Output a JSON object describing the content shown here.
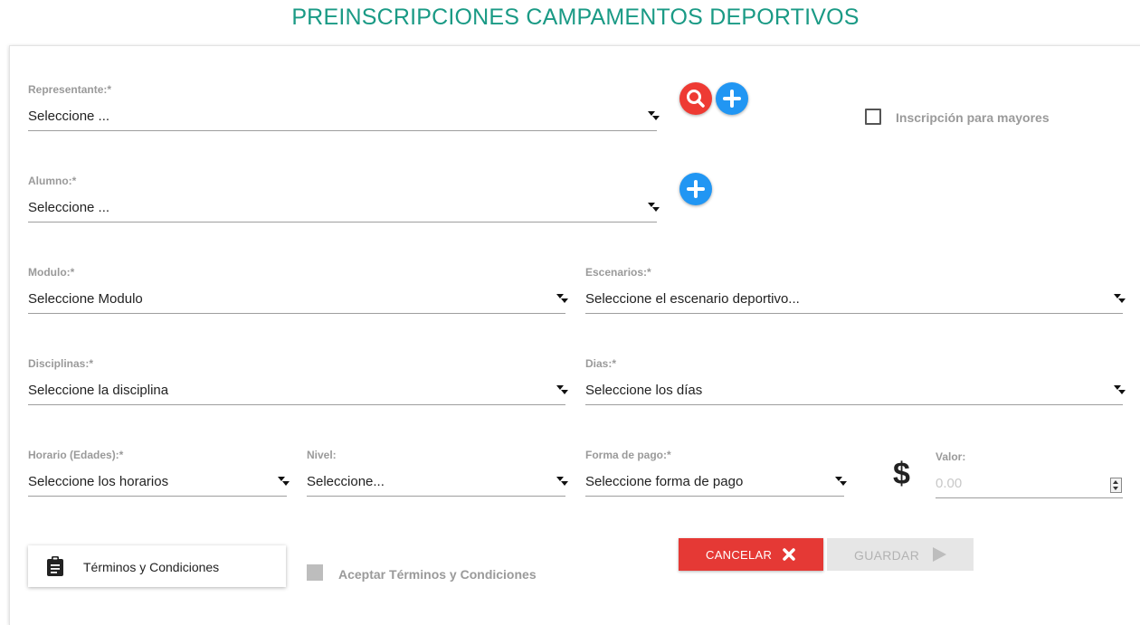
{
  "title": "PREINSCRIPCIONES CAMPAMENTOS DEPORTIVOS",
  "representante": {
    "label": "Representante:*",
    "value": "Seleccione ..."
  },
  "mayores": {
    "label": "Inscripción para mayores",
    "checked": false
  },
  "alumno": {
    "label": "Alumno:*",
    "value": "Seleccione ..."
  },
  "modulo": {
    "label": "Modulo:*",
    "value": "Seleccione Modulo"
  },
  "escenarios": {
    "label": "Escenarios:*",
    "value": "Seleccione el escenario deportivo..."
  },
  "disciplinas": {
    "label": "Disciplinas:*",
    "value": "Seleccione la disciplina"
  },
  "dias": {
    "label": "Dias:*",
    "value": "Seleccione los días"
  },
  "horario": {
    "label": "Horario (Edades):*",
    "value": "Seleccione los horarios"
  },
  "nivel": {
    "label": "Nivel:",
    "value": "Seleccione..."
  },
  "forma_pago": {
    "label": "Forma de pago:*",
    "value": "Seleccione forma de pago"
  },
  "valor": {
    "symbol": "$",
    "label": "Valor:",
    "placeholder": "0.00"
  },
  "terms": {
    "button_label": "Términos y Condiciones",
    "accept_label": "Aceptar Términos y Condiciones",
    "accepted": false
  },
  "actions": {
    "cancel_label": "CANCELAR",
    "save_label": "GUARDAR"
  },
  "colors": {
    "title": "#1a9a85",
    "search_button": "#ee3a33",
    "add_button": "#2196f3",
    "cancel_button": "#e53935",
    "save_button_disabled": "#e6e6e6"
  },
  "icons": {
    "search": "search-icon",
    "add": "plus-icon",
    "clipboard": "clipboard-icon",
    "cancel": "close-x-icon",
    "save": "play-arrow-icon"
  }
}
